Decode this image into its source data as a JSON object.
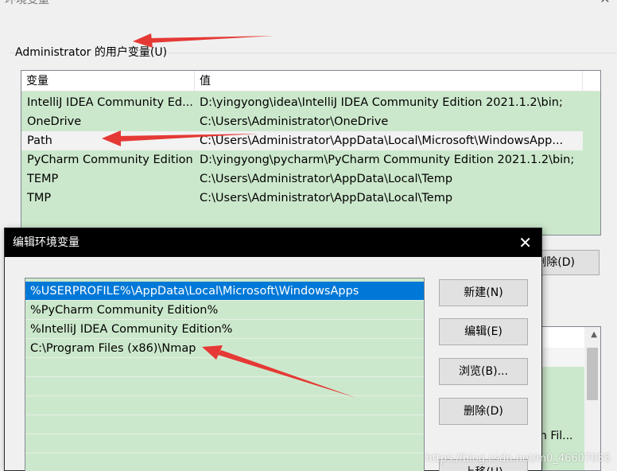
{
  "background_window": {
    "title": "环境变量",
    "close_glyph": "✕",
    "user_group_label": "Administrator 的用户变量(U)",
    "columns": {
      "name": "变量",
      "value": "值"
    },
    "variables": [
      {
        "name": "IntelliJ IDEA Community Ed...",
        "value": "D:\\yingyong\\idea\\IntelliJ IDEA Community Edition 2021.1.2\\bin;"
      },
      {
        "name": "OneDrive",
        "value": "C:\\Users\\Administrator\\OneDrive"
      },
      {
        "name": "Path",
        "value": "C:\\Users\\Administrator\\AppData\\Local\\Microsoft\\WindowsApp..."
      },
      {
        "name": "PyCharm Community Edition",
        "value": "D:\\yingyong\\pycharm\\PyCharm Community Edition 2021.1.2\\bin;"
      },
      {
        "name": "TEMP",
        "value": "C:\\Users\\Administrator\\AppData\\Local\\Temp"
      },
      {
        "name": "TMP",
        "value": "C:\\Users\\Administrator\\AppData\\Local\\Temp"
      }
    ],
    "selected_variable_index": 2,
    "delete_button_partial": "删除(D)",
    "system_list_partial_text": "n Fil..."
  },
  "edit_dialog": {
    "title": "编辑环境变量",
    "close_glyph": "✕",
    "entries": [
      "%USERPROFILE%\\AppData\\Local\\Microsoft\\WindowsApps",
      "%PyCharm Community Edition%",
      "%IntelliJ IDEA Community Edition%",
      "C:\\Program Files (x86)\\Nmap"
    ],
    "selected_entry_index": 0,
    "buttons": {
      "new": "新建(N)",
      "edit": "编辑(E)",
      "browse": "浏览(B)...",
      "delete": "删除(D)",
      "move_up": "上移(U)"
    }
  },
  "watermark": "https://blog.csdn.net/m0_46607055",
  "colors": {
    "list_background": "#cce8cc",
    "selection": "#0078d7",
    "annotation_arrow": "#e53935",
    "dialog_titlebar": "#000000"
  }
}
